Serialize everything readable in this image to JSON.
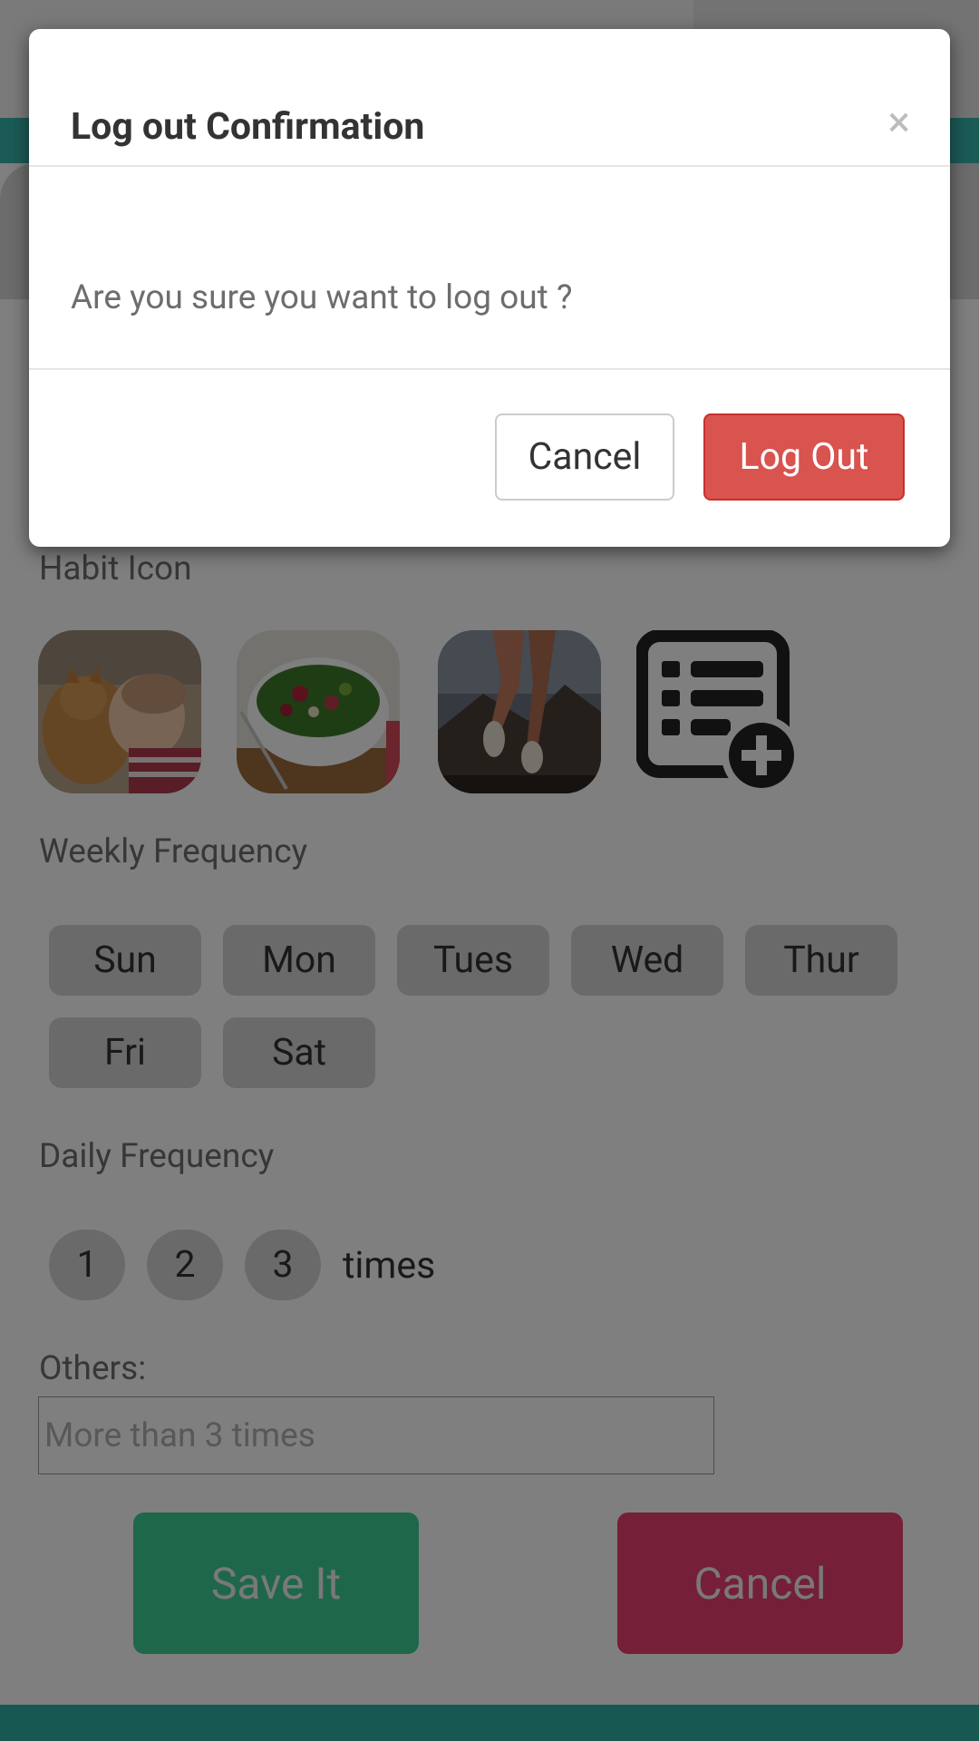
{
  "dialog": {
    "title": "Log out Confirmation",
    "close_symbol": "×",
    "message": "Are you sure you want to log out ?",
    "cancel_label": "Cancel",
    "logout_label": "Log Out"
  },
  "form": {
    "habit_icon_label": "Habit Icon",
    "habit_icons": [
      "cat-baby-photo",
      "salad-bowl-photo",
      "running-legs-photo",
      "add-list-icon"
    ],
    "weekly_label": "Weekly Frequency",
    "days": [
      "Sun",
      "Mon",
      "Tues",
      "Wed",
      "Thur",
      "Fri",
      "Sat"
    ],
    "daily_label": "Daily Frequency",
    "daily_options": [
      "1",
      "2",
      "3"
    ],
    "times_label": "times",
    "others_label": "Others:",
    "others_placeholder": "More than 3 times",
    "save_label": "Save It",
    "cancel_label": "Cancel"
  },
  "colors": {
    "teal": "#37b7ac",
    "save": "#3fcf97",
    "cancel": "#ea3f73",
    "logout": "#d9534f"
  }
}
